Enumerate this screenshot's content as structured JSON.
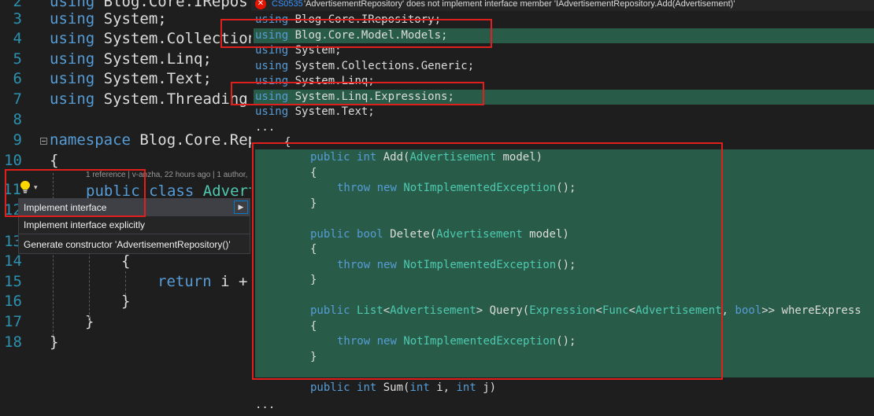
{
  "editor": {
    "line_numbers": [
      "2",
      "3",
      "4",
      "5",
      "6",
      "7",
      "8",
      "9",
      "10",
      "11",
      "12",
      "13",
      "14",
      "15",
      "16",
      "17",
      "18"
    ],
    "lines": {
      "l2": {
        "kw": "using",
        "rest": " Blog.Core.IRepos"
      },
      "l3": {
        "kw": "using",
        "rest": " System;"
      },
      "l4": {
        "kw": "using",
        "rest": " System.Collection"
      },
      "l5": {
        "kw": "using",
        "rest": " System.Linq;"
      },
      "l6": {
        "kw": "using",
        "rest": " System.Text;"
      },
      "l7": {
        "kw": "using",
        "rest": " System.Threading"
      },
      "l9": {
        "kw": "namespace",
        "rest": " Blog.Core.Rep"
      },
      "l10": "{",
      "l11": {
        "kw1": "public",
        "kw2": "class",
        "type": "Advert"
      },
      "l14": "{",
      "l15": {
        "kw": "return",
        "rest": " i +"
      },
      "l16": "}",
      "l17": "}",
      "l18": "}"
    },
    "codelens": "1 reference | v-anzha, 22 hours ago | 1 author,"
  },
  "quick_actions": {
    "items": [
      "Implement interface",
      "Implement interface explicitly",
      "Generate constructor 'AdvertisementRepository()'"
    ],
    "selected_index": 0
  },
  "preview": {
    "diagnostic": {
      "code": "CS0535",
      "message": "'AdvertisementRepository' does not implement interface member 'IAdvertisementRepository.Add(Advertisement)'"
    },
    "usings": [
      {
        "kw": "using",
        "ns": " Blog.Core.IRepository;"
      },
      {
        "kw": "using",
        "ns": " Blog.Core.Model.Models;"
      },
      {
        "kw": "using",
        "ns": " System;"
      },
      {
        "kw": "using",
        "ns": " System.Collections.Generic;"
      },
      {
        "kw": "using",
        "ns": " System.Linq;"
      },
      {
        "kw": "using",
        "ns": " System.Linq.Expressions;"
      },
      {
        "kw": "using",
        "ns": " System.Text;"
      }
    ],
    "ellipsis": "...",
    "open_brace": "{",
    "methods": {
      "add": {
        "kw1": "public",
        "kw2": "int",
        "name": " Add(",
        "ptype": "Advertisement",
        "rest": " model)"
      },
      "delete": {
        "kw1": "public",
        "kw2": "bool",
        "name": " Delete(",
        "ptype": "Advertisement",
        "rest": " model)"
      },
      "query": {
        "kw1": "public",
        "t1": "List",
        "t2": "Advertisement",
        "name": " Query(",
        "t3": "Expression",
        "t4": "Func",
        "t5": "Advertisement",
        "kw3": "bool",
        "rest": ">> whereExpress"
      },
      "sum": {
        "kw1": "public",
        "kw2": "int",
        "name": " Sum(",
        "kw3": "int",
        "mid": " i, ",
        "kw4": "int",
        "rest": " j)"
      }
    },
    "brace_open": "{",
    "brace_close": "}",
    "throw_kw": "throw",
    "new_kw": "new",
    "exception": "NotImplementedException",
    "throw_tail": "();"
  },
  "colors": {
    "keyword": "#569cd6",
    "type": "#4ec9b0",
    "added_highlight": "#285c49",
    "annotation": "#e0201c",
    "error": "#e51400"
  }
}
